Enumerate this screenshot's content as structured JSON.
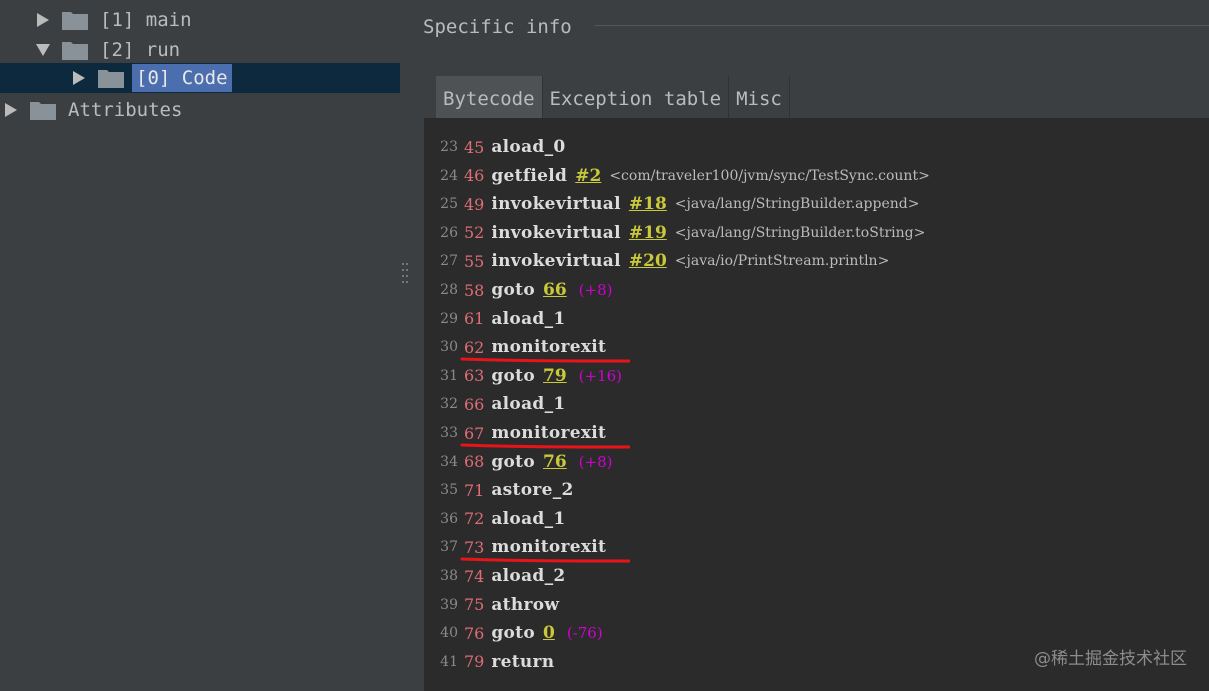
{
  "tree": {
    "items": [
      {
        "label": "[1] main",
        "expanded": false
      },
      {
        "label": "[2] run",
        "expanded": true
      },
      {
        "label": "[0] Code",
        "expanded": false,
        "selected": true
      },
      {
        "label": "Attributes",
        "expanded": false
      }
    ]
  },
  "details": {
    "title": "Specific info",
    "tabs": [
      {
        "label": "Bytecode",
        "active": true
      },
      {
        "label": "Exception table",
        "active": false
      },
      {
        "label": "Misc",
        "active": false
      }
    ]
  },
  "bytecode": {
    "rows": [
      {
        "ln": "23",
        "offset": "45",
        "op": "aload_0",
        "arg": "",
        "delta": "",
        "ref": ""
      },
      {
        "ln": "24",
        "offset": "46",
        "op": "getfield",
        "arg": "#2",
        "delta": "",
        "ref": "<com/traveler100/jvm/sync/TestSync.count>"
      },
      {
        "ln": "25",
        "offset": "49",
        "op": "invokevirtual",
        "arg": "#18",
        "delta": "",
        "ref": "<java/lang/StringBuilder.append>"
      },
      {
        "ln": "26",
        "offset": "52",
        "op": "invokevirtual",
        "arg": "#19",
        "delta": "",
        "ref": "<java/lang/StringBuilder.toString>"
      },
      {
        "ln": "27",
        "offset": "55",
        "op": "invokevirtual",
        "arg": "#20",
        "delta": "",
        "ref": "<java/io/PrintStream.println>"
      },
      {
        "ln": "28",
        "offset": "58",
        "op": "goto",
        "arg": "66",
        "delta": "(+8)",
        "ref": ""
      },
      {
        "ln": "29",
        "offset": "61",
        "op": "aload_1",
        "arg": "",
        "delta": "",
        "ref": ""
      },
      {
        "ln": "30",
        "offset": "62",
        "op": "monitorexit",
        "arg": "",
        "delta": "",
        "ref": "",
        "highlighted": true
      },
      {
        "ln": "31",
        "offset": "63",
        "op": "goto",
        "arg": "79",
        "delta": "(+16)",
        "ref": ""
      },
      {
        "ln": "32",
        "offset": "66",
        "op": "aload_1",
        "arg": "",
        "delta": "",
        "ref": ""
      },
      {
        "ln": "33",
        "offset": "67",
        "op": "monitorexit",
        "arg": "",
        "delta": "",
        "ref": "",
        "highlighted": true
      },
      {
        "ln": "34",
        "offset": "68",
        "op": "goto",
        "arg": "76",
        "delta": "(+8)",
        "ref": ""
      },
      {
        "ln": "35",
        "offset": "71",
        "op": "astore_2",
        "arg": "",
        "delta": "",
        "ref": ""
      },
      {
        "ln": "36",
        "offset": "72",
        "op": "aload_1",
        "arg": "",
        "delta": "",
        "ref": ""
      },
      {
        "ln": "37",
        "offset": "73",
        "op": "monitorexit",
        "arg": "",
        "delta": "",
        "ref": "",
        "highlighted": true
      },
      {
        "ln": "38",
        "offset": "74",
        "op": "aload_2",
        "arg": "",
        "delta": "",
        "ref": ""
      },
      {
        "ln": "39",
        "offset": "75",
        "op": "athrow",
        "arg": "",
        "delta": "",
        "ref": ""
      },
      {
        "ln": "40",
        "offset": "76",
        "op": "goto",
        "arg": "0",
        "delta": "(-76)",
        "ref": ""
      },
      {
        "ln": "41",
        "offset": "79",
        "op": "return",
        "arg": "",
        "delta": "",
        "ref": ""
      }
    ]
  },
  "colors": {
    "offset": "#e06c75",
    "argument": "#c9c93a",
    "delta": "#d000d0",
    "annotation_underline": "#e8141a",
    "selection": "#4b6eaf"
  },
  "watermark": "@稀土掘金技术社区"
}
